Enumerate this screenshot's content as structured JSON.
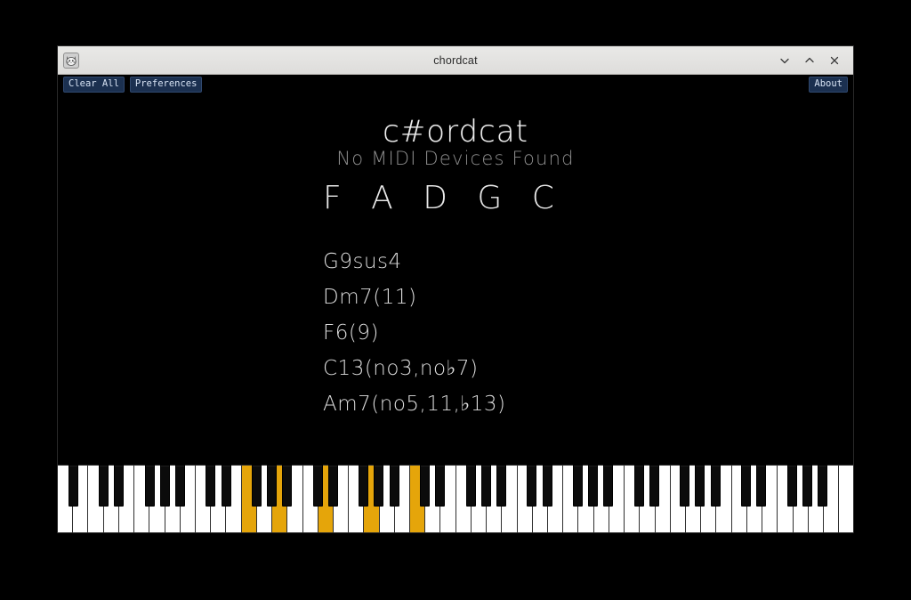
{
  "window": {
    "title": "chordcat",
    "icon": "cat-face-icon",
    "controls": [
      {
        "name": "minimize-button",
        "glyph": "chevron-down-icon"
      },
      {
        "name": "maximize-button",
        "glyph": "chevron-up-icon"
      },
      {
        "name": "close-button",
        "glyph": "close-icon"
      }
    ]
  },
  "toolbar": {
    "clear_all_label": "Clear All",
    "preferences_label": "Preferences",
    "about_label": "About"
  },
  "main": {
    "app_title": "c#ordcat",
    "midi_status": "No MIDI Devices Found",
    "notes_label": "F A D G C",
    "notes": [
      "F",
      "A",
      "D",
      "G",
      "C"
    ],
    "chords": [
      "G9sus4",
      "Dm7(11)",
      "F6(9)",
      "C13(no3,no♭7)",
      "Am7(no5,11,♭13)"
    ]
  },
  "piano": {
    "white_key_count": 52,
    "start_note": "A0",
    "end_note": "C8",
    "active_color": "#e5a50a",
    "white_key_color": "#ffffff",
    "black_key_color": "#0b0b0b",
    "active_white_key_indices": [
      12,
      14,
      17,
      20,
      23
    ],
    "active_white_key_notes": [
      "F3",
      "A3",
      "D4",
      "G4",
      "C5"
    ],
    "active_black_key_indices": []
  },
  "colors": {
    "background": "#000000",
    "titlebar": "#e3e2e0",
    "button_bg": "#1b3050",
    "button_text": "#d7e3f4",
    "text_primary": "#e6e6e6",
    "text_muted": "#8e8e8e",
    "accent": "#e5a50a"
  }
}
